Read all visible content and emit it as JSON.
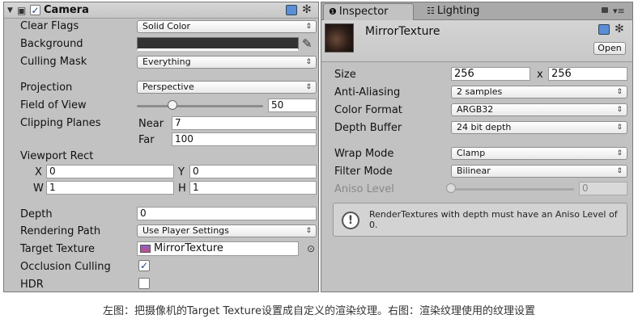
{
  "camera": {
    "title": "Camera",
    "enabled_check": "✓",
    "clear_flags_label": "Clear Flags",
    "clear_flags_value": "Solid Color",
    "background_label": "Background",
    "background_color": "#333333",
    "culling_mask_label": "Culling Mask",
    "culling_mask_value": "Everything",
    "projection_label": "Projection",
    "projection_value": "Perspective",
    "fov_label": "Field of View",
    "fov_value": "50",
    "fov_fraction": 0.28,
    "clipping_label": "Clipping Planes",
    "near_label": "Near",
    "near_value": "7",
    "far_label": "Far",
    "far_value": "100",
    "viewport_label": "Viewport Rect",
    "x_label": "X",
    "x_value": "0",
    "y_label": "Y",
    "y_value": "0",
    "w_label": "W",
    "w_value": "1",
    "h_label": "H",
    "h_value": "1",
    "depth_label": "Depth",
    "depth_value": "0",
    "rendering_path_label": "Rendering Path",
    "rendering_path_value": "Use Player Settings",
    "target_texture_label": "Target Texture",
    "target_texture_value": "MirrorTexture",
    "occlusion_label": "Occlusion Culling",
    "occlusion_check": "✓",
    "hdr_label": "HDR",
    "hdr_check": ""
  },
  "tabs": {
    "inspector": "Inspector",
    "lighting": "Lighting"
  },
  "texture": {
    "name": "MirrorTexture",
    "open_label": "Open",
    "size_label": "Size",
    "size_w": "256",
    "size_x": "x",
    "size_h": "256",
    "aa_label": "Anti-Aliasing",
    "aa_value": "2 samples",
    "color_format_label": "Color Format",
    "color_format_value": "ARGB32",
    "depth_buffer_label": "Depth Buffer",
    "depth_buffer_value": "24 bit depth",
    "wrap_label": "Wrap Mode",
    "wrap_value": "Clamp",
    "filter_label": "Filter Mode",
    "filter_value": "Bilinear",
    "aniso_label": "Aniso Level",
    "aniso_value": "0",
    "aniso_fraction": 0.0,
    "warning": "RenderTextures with depth must have an Aniso Level of 0."
  },
  "caption": "左图：把摄像机的Target Texture设置成自定义的渲染纹理。右图：渲染纹理使用的纹理设置",
  "icons": {
    "dropdown_arrow": "⇕",
    "eyedropper": "✎",
    "target_circle": "⊙",
    "gear": "✻",
    "info": "❶",
    "lock": "🔒",
    "warning": "!"
  }
}
